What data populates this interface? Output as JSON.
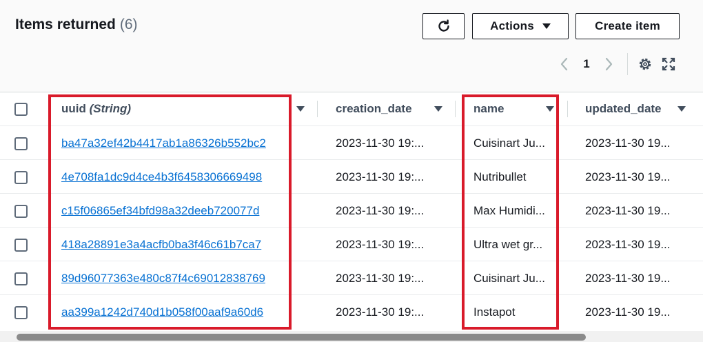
{
  "header": {
    "title": "Items returned",
    "count": "(6)"
  },
  "toolbar": {
    "refresh_icon": "refresh-icon",
    "actions_label": "Actions",
    "create_label": "Create item"
  },
  "pagination": {
    "current_page": "1",
    "prev_icon": "chevron-left-icon",
    "next_icon": "chevron-right-icon",
    "settings_icon": "gear-icon",
    "fullscreen_icon": "expand-icon"
  },
  "table": {
    "columns": {
      "uuid": "uuid",
      "uuid_type": "(String)",
      "creation_date": "creation_date",
      "name": "name",
      "updated_date": "updated_date"
    },
    "rows": [
      {
        "uuid": "ba47a32ef42b4417ab1a86326b552bc2",
        "creation_date": "2023-11-30 19:...",
        "name": "Cuisinart Ju...",
        "updated_date": "2023-11-30 19..."
      },
      {
        "uuid": "4e708fa1dc9d4ce4b3f6458306669498",
        "creation_date": "2023-11-30 19:...",
        "name": "Nutribullet",
        "updated_date": "2023-11-30 19..."
      },
      {
        "uuid": "c15f06865ef34bfd98a32deeb720077d",
        "creation_date": "2023-11-30 19:...",
        "name": "Max Humidi...",
        "updated_date": "2023-11-30 19..."
      },
      {
        "uuid": "418a28891e3a4acfb0ba3f46c61b7ca7",
        "creation_date": "2023-11-30 19:...",
        "name": "Ultra wet gr...",
        "updated_date": "2023-11-30 19..."
      },
      {
        "uuid": "89d96077363e480c87f4c69012838769",
        "creation_date": "2023-11-30 19:...",
        "name": "Cuisinart Ju...",
        "updated_date": "2023-11-30 19..."
      },
      {
        "uuid": "aa399a1242d740d1b058f00aaf9a60d6",
        "creation_date": "2023-11-30 19:...",
        "name": "Instapot",
        "updated_date": "2023-11-30 19..."
      }
    ]
  },
  "colors": {
    "link": "#0972d3",
    "highlight": "#d91a2a",
    "text": "#16191f"
  }
}
